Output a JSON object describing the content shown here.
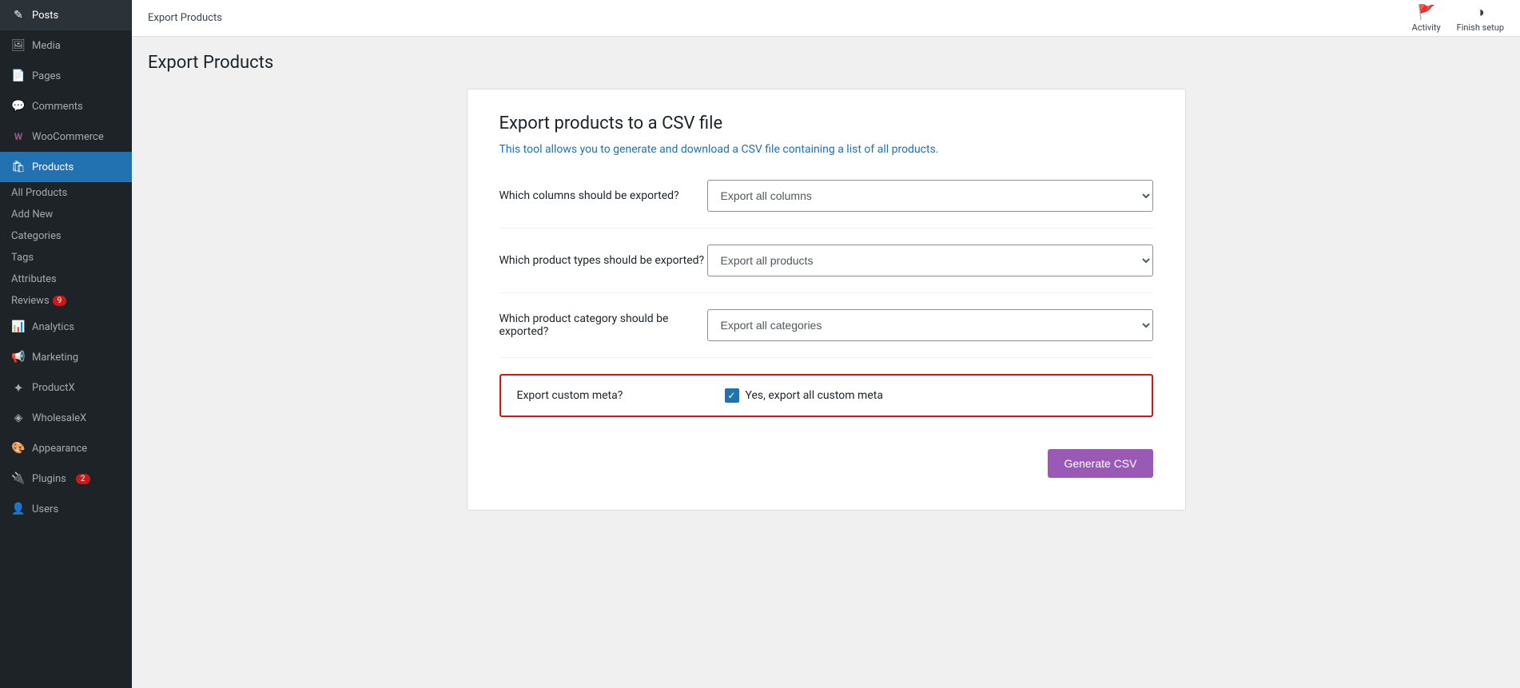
{
  "sidebar": {
    "items": [
      {
        "id": "posts",
        "label": "Posts",
        "icon": "✎",
        "active": false
      },
      {
        "id": "media",
        "label": "Media",
        "icon": "🖼",
        "active": false
      },
      {
        "id": "pages",
        "label": "Pages",
        "icon": "📄",
        "active": false
      },
      {
        "id": "comments",
        "label": "Comments",
        "icon": "💬",
        "active": false
      },
      {
        "id": "woocommerce",
        "label": "WooCommerce",
        "icon": "W",
        "active": false
      },
      {
        "id": "products",
        "label": "Products",
        "icon": "🛍",
        "active": true
      },
      {
        "id": "analytics",
        "label": "Analytics",
        "icon": "📊",
        "active": false
      },
      {
        "id": "marketing",
        "label": "Marketing",
        "icon": "📢",
        "active": false
      },
      {
        "id": "productx",
        "label": "ProductX",
        "icon": "✦",
        "active": false
      },
      {
        "id": "wholesalex",
        "label": "WholesaleX",
        "icon": "◈",
        "active": false
      },
      {
        "id": "appearance",
        "label": "Appearance",
        "icon": "🎨",
        "active": false
      },
      {
        "id": "plugins",
        "label": "Plugins",
        "icon": "🔌",
        "active": false,
        "badge": "2"
      },
      {
        "id": "users",
        "label": "Users",
        "icon": "👤",
        "active": false
      }
    ],
    "products_sub": [
      {
        "id": "all-products",
        "label": "All Products",
        "active": false
      },
      {
        "id": "add-new",
        "label": "Add New",
        "active": false
      },
      {
        "id": "categories",
        "label": "Categories",
        "active": false
      },
      {
        "id": "tags",
        "label": "Tags",
        "active": false
      },
      {
        "id": "attributes",
        "label": "Attributes",
        "active": false
      },
      {
        "id": "reviews",
        "label": "Reviews",
        "active": false,
        "badge": "9"
      }
    ]
  },
  "topbar": {
    "breadcrumb": "Export Products",
    "activity_label": "Activity",
    "finish_setup_label": "Finish setup"
  },
  "page": {
    "title": "Export Products",
    "card": {
      "title": "Export products to a CSV file",
      "description": "This tool allows you to generate and download a CSV file containing a list of all products.",
      "fields": [
        {
          "id": "columns",
          "label": "Which columns should be exported?",
          "placeholder": "Export all columns"
        },
        {
          "id": "product_types",
          "label": "Which product types should be exported?",
          "placeholder": "Export all products"
        },
        {
          "id": "category",
          "label": "Which product category should be exported?",
          "placeholder": "Export all categories"
        }
      ],
      "custom_meta_label": "Export custom meta?",
      "custom_meta_checkbox_label": "Yes, export all custom meta",
      "custom_meta_checked": true,
      "generate_button": "Generate CSV"
    }
  }
}
